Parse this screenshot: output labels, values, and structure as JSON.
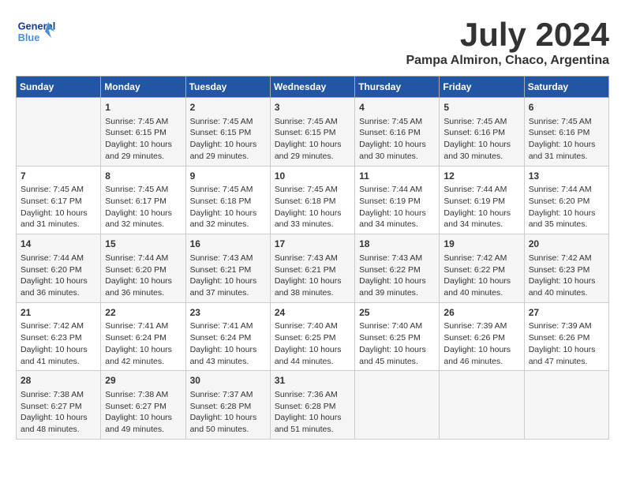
{
  "header": {
    "logo_text_top": "General",
    "logo_text_bottom": "Blue",
    "month": "July 2024",
    "location": "Pampa Almiron, Chaco, Argentina"
  },
  "calendar": {
    "days_of_week": [
      "Sunday",
      "Monday",
      "Tuesday",
      "Wednesday",
      "Thursday",
      "Friday",
      "Saturday"
    ],
    "rows": [
      [
        {
          "day": "",
          "content": ""
        },
        {
          "day": "1",
          "content": "Sunrise: 7:45 AM\nSunset: 6:15 PM\nDaylight: 10 hours\nand 29 minutes."
        },
        {
          "day": "2",
          "content": "Sunrise: 7:45 AM\nSunset: 6:15 PM\nDaylight: 10 hours\nand 29 minutes."
        },
        {
          "day": "3",
          "content": "Sunrise: 7:45 AM\nSunset: 6:15 PM\nDaylight: 10 hours\nand 29 minutes."
        },
        {
          "day": "4",
          "content": "Sunrise: 7:45 AM\nSunset: 6:16 PM\nDaylight: 10 hours\nand 30 minutes."
        },
        {
          "day": "5",
          "content": "Sunrise: 7:45 AM\nSunset: 6:16 PM\nDaylight: 10 hours\nand 30 minutes."
        },
        {
          "day": "6",
          "content": "Sunrise: 7:45 AM\nSunset: 6:16 PM\nDaylight: 10 hours\nand 31 minutes."
        }
      ],
      [
        {
          "day": "7",
          "content": "Sunrise: 7:45 AM\nSunset: 6:17 PM\nDaylight: 10 hours\nand 31 minutes."
        },
        {
          "day": "8",
          "content": "Sunrise: 7:45 AM\nSunset: 6:17 PM\nDaylight: 10 hours\nand 32 minutes."
        },
        {
          "day": "9",
          "content": "Sunrise: 7:45 AM\nSunset: 6:18 PM\nDaylight: 10 hours\nand 32 minutes."
        },
        {
          "day": "10",
          "content": "Sunrise: 7:45 AM\nSunset: 6:18 PM\nDaylight: 10 hours\nand 33 minutes."
        },
        {
          "day": "11",
          "content": "Sunrise: 7:44 AM\nSunset: 6:19 PM\nDaylight: 10 hours\nand 34 minutes."
        },
        {
          "day": "12",
          "content": "Sunrise: 7:44 AM\nSunset: 6:19 PM\nDaylight: 10 hours\nand 34 minutes."
        },
        {
          "day": "13",
          "content": "Sunrise: 7:44 AM\nSunset: 6:20 PM\nDaylight: 10 hours\nand 35 minutes."
        }
      ],
      [
        {
          "day": "14",
          "content": "Sunrise: 7:44 AM\nSunset: 6:20 PM\nDaylight: 10 hours\nand 36 minutes."
        },
        {
          "day": "15",
          "content": "Sunrise: 7:44 AM\nSunset: 6:20 PM\nDaylight: 10 hours\nand 36 minutes."
        },
        {
          "day": "16",
          "content": "Sunrise: 7:43 AM\nSunset: 6:21 PM\nDaylight: 10 hours\nand 37 minutes."
        },
        {
          "day": "17",
          "content": "Sunrise: 7:43 AM\nSunset: 6:21 PM\nDaylight: 10 hours\nand 38 minutes."
        },
        {
          "day": "18",
          "content": "Sunrise: 7:43 AM\nSunset: 6:22 PM\nDaylight: 10 hours\nand 39 minutes."
        },
        {
          "day": "19",
          "content": "Sunrise: 7:42 AM\nSunset: 6:22 PM\nDaylight: 10 hours\nand 40 minutes."
        },
        {
          "day": "20",
          "content": "Sunrise: 7:42 AM\nSunset: 6:23 PM\nDaylight: 10 hours\nand 40 minutes."
        }
      ],
      [
        {
          "day": "21",
          "content": "Sunrise: 7:42 AM\nSunset: 6:23 PM\nDaylight: 10 hours\nand 41 minutes."
        },
        {
          "day": "22",
          "content": "Sunrise: 7:41 AM\nSunset: 6:24 PM\nDaylight: 10 hours\nand 42 minutes."
        },
        {
          "day": "23",
          "content": "Sunrise: 7:41 AM\nSunset: 6:24 PM\nDaylight: 10 hours\nand 43 minutes."
        },
        {
          "day": "24",
          "content": "Sunrise: 7:40 AM\nSunset: 6:25 PM\nDaylight: 10 hours\nand 44 minutes."
        },
        {
          "day": "25",
          "content": "Sunrise: 7:40 AM\nSunset: 6:25 PM\nDaylight: 10 hours\nand 45 minutes."
        },
        {
          "day": "26",
          "content": "Sunrise: 7:39 AM\nSunset: 6:26 PM\nDaylight: 10 hours\nand 46 minutes."
        },
        {
          "day": "27",
          "content": "Sunrise: 7:39 AM\nSunset: 6:26 PM\nDaylight: 10 hours\nand 47 minutes."
        }
      ],
      [
        {
          "day": "28",
          "content": "Sunrise: 7:38 AM\nSunset: 6:27 PM\nDaylight: 10 hours\nand 48 minutes."
        },
        {
          "day": "29",
          "content": "Sunrise: 7:38 AM\nSunset: 6:27 PM\nDaylight: 10 hours\nand 49 minutes."
        },
        {
          "day": "30",
          "content": "Sunrise: 7:37 AM\nSunset: 6:28 PM\nDaylight: 10 hours\nand 50 minutes."
        },
        {
          "day": "31",
          "content": "Sunrise: 7:36 AM\nSunset: 6:28 PM\nDaylight: 10 hours\nand 51 minutes."
        },
        {
          "day": "",
          "content": ""
        },
        {
          "day": "",
          "content": ""
        },
        {
          "day": "",
          "content": ""
        }
      ]
    ]
  }
}
